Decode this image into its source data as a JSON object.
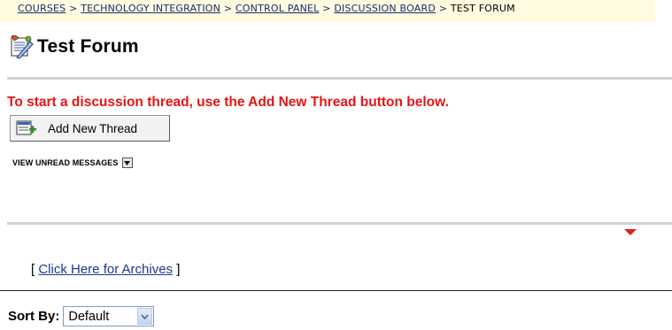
{
  "breadcrumb": {
    "items": [
      "COURSES",
      "TECHNOLOGY INTEGRATION",
      "CONTROL PANEL",
      "DISCUSSION BOARD"
    ],
    "separator": ">",
    "current": "TEST FORUM"
  },
  "header": {
    "title": "Test Forum",
    "icon": "forum-icon"
  },
  "instruction": "To start a discussion thread, use the Add New Thread button below.",
  "toolbar": {
    "add_thread_label": "Add New Thread",
    "add_thread_icon": "add-thread-icon"
  },
  "view_unread": {
    "label": "VIEW UNREAD MESSAGES",
    "icon": "dropdown-arrow-icon"
  },
  "archives": {
    "open_bracket": "[",
    "link_label": "Click Here for Archives",
    "close_bracket": "]"
  },
  "sort": {
    "label": "Sort By:",
    "selected": "Default"
  },
  "colors": {
    "instruction": "#e61414",
    "breadcrumb_bg": "#fffbe0",
    "link": "#1a2a6e",
    "marker": "#e02020"
  }
}
